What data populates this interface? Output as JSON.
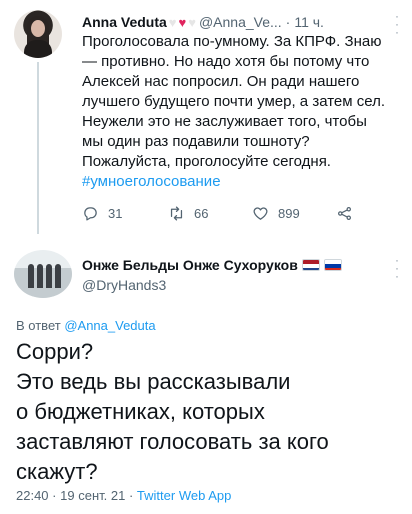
{
  "parent_tweet": {
    "author_name": "Anna Veduta",
    "emoji": [
      "🤍",
      "❤️",
      "🤍"
    ],
    "handle": "@Anna_Ve...",
    "separator": "·",
    "time": "11 ч.",
    "text": "Проголосовала по-умному. За КПРФ. Знаю\n— противно. Но надо хотя бы потому что\nАлексей нас попросил. Он ради нашего\nлучшего будущего почти умер, а затем сел.\nНеужели это не заслуживает того, чтобы\nмы один раз подавили тошноту?\nПожалуйста, проголосуйте сегодня.",
    "hashtag": "#умноеголосование",
    "replies": "31",
    "retweets": "66",
    "likes": "899"
  },
  "reply_tweet": {
    "author_name": "Онже Бельды Онже Сухоруков",
    "flags": [
      "netherlands-flag",
      "russia-flag"
    ],
    "handle": "@DryHands3",
    "in_reply_prefix": "В ответ",
    "in_reply_handle": "@Anna_Veduta",
    "text": "Сорри?\nЭто ведь вы рассказывали\nо бюджетниках, которых\nзаставляют голосовать за кого\nскажут?",
    "time": "22:40",
    "date": "19 сент. 21",
    "separator": "·",
    "source": "Twitter Web App"
  },
  "colors": {
    "link": "#1d9bf0",
    "secondary_text": "#536471",
    "primary_text": "#0f1419",
    "heart": "#e0245e"
  }
}
